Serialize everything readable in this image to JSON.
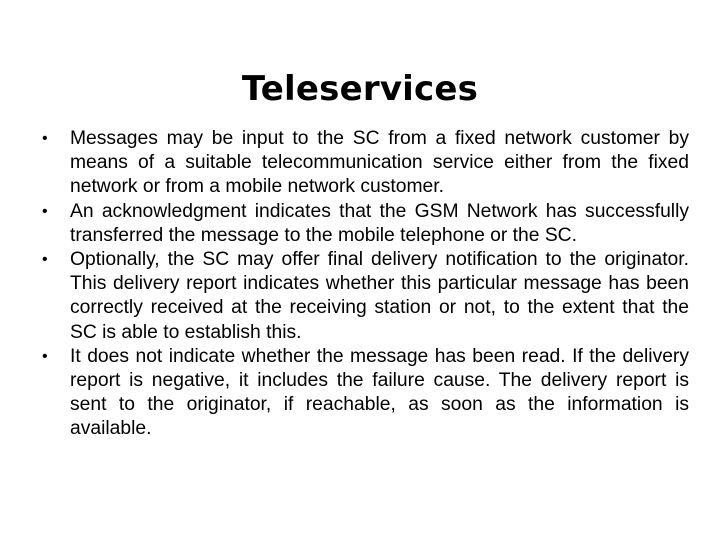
{
  "slide": {
    "title": "Teleservices",
    "bullets": [
      {
        "marker": "•",
        "text": "Messages may be input to the SC from a fixed network customer by means of a suitable telecommunication service either from the fixed network or from a mobile network customer."
      },
      {
        "marker": "•",
        "text": "An acknowledgment indicates that the GSM Network has successfully transferred the message to the mobile telephone or the SC."
      },
      {
        "marker": "•",
        "text": "Optionally, the SC may offer final delivery notification to the originator. This delivery report indicates whether this particular message has been correctly received at the receiving station or not, to the extent that the SC is able to establish this."
      },
      {
        "marker": "•",
        "text": "It does not indicate whether the message has been read. If the delivery report is negative, it includes the failure cause. The delivery report is sent to the originator, if reachable, as soon as the information is available."
      }
    ]
  }
}
